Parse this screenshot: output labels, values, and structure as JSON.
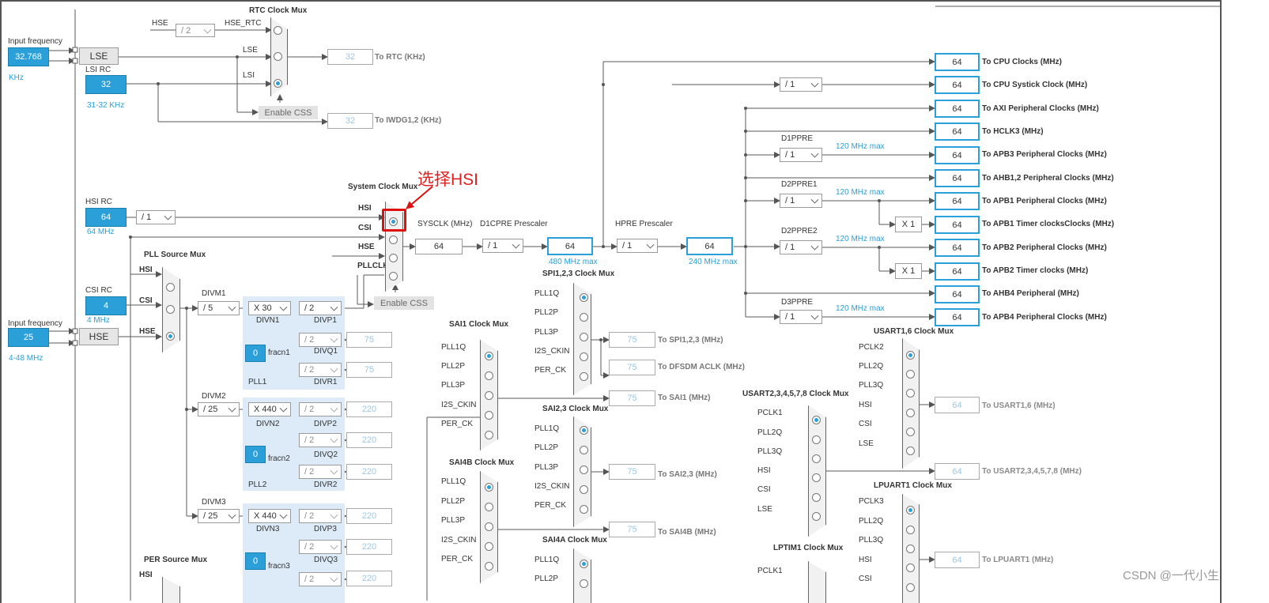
{
  "colors": {
    "accent": "#2a9fd8",
    "wire": "#5a5a5a",
    "highlight": "#e01010",
    "pll_fill": "#dcebf7"
  },
  "annotation": {
    "text": "选择HSI"
  },
  "watermark": {
    "text": "CSDN @一代小生"
  },
  "common": {
    "enable_css": "Enable CSS",
    "fracn_value": "0",
    "max_120": "120 MHz max"
  },
  "lse": {
    "input_label": "Input frequency",
    "value": "32.768",
    "unit": "KHz",
    "block": "LSE"
  },
  "lsi": {
    "label": "LSI RC",
    "value": "32",
    "range": "31-32 KHz"
  },
  "rtc": {
    "title": "RTC Clock Mux",
    "hse": "HSE",
    "div": "/ 2",
    "hse_rtc": "HSE_RTC",
    "lse": "LSE",
    "lsi": "LSI",
    "out": "32",
    "out_label": "To RTC (KHz)",
    "iwdg_out": "32",
    "iwdg_label": "To IWDG1,2 (KHz)"
  },
  "hsi": {
    "label": "HSI RC",
    "value": "64",
    "unit": "64 MHz",
    "div": "/ 1"
  },
  "csi": {
    "label": "CSI RC",
    "value": "4",
    "unit": "4 MHz"
  },
  "hse": {
    "input_label": "Input frequency",
    "value": "25",
    "block": "HSE",
    "range": "4-48 MHz"
  },
  "sysmux": {
    "title": "System Clock Mux",
    "hsi": "HSI",
    "csi": "CSI",
    "hse": "HSE",
    "pllclk": "PLLCLK"
  },
  "pllsrc": {
    "title": "PLL Source Mux",
    "hsi": "HSI",
    "csi": "CSI",
    "hse": "HSE"
  },
  "pll1": {
    "divm_label": "DIVM1",
    "divm": "/ 5",
    "mult": "X 30",
    "divn": "DIVN1",
    "p": "/ 2",
    "p_label": "DIVP1",
    "q": "/ 2",
    "q_label": "DIVQ1",
    "q_out": "75",
    "r": "/ 2",
    "r_label": "DIVR1",
    "r_out": "75",
    "fracn": "fracn1",
    "name": "PLL1"
  },
  "pll2": {
    "divm_label": "DIVM2",
    "divm": "/ 25",
    "mult": "X 440",
    "divn": "DIVN2",
    "p": "/ 2",
    "p_label": "DIVP2",
    "p_out": "220",
    "q": "/ 2",
    "q_label": "DIVQ2",
    "q_out": "220",
    "r": "/ 2",
    "r_label": "DIVR2",
    "r_out": "220",
    "fracn": "fracn2",
    "name": "PLL2"
  },
  "pll3": {
    "divm_label": "DIVM3",
    "divm": "/ 25",
    "mult": "X 440",
    "divn": "DIVN3",
    "p": "/ 2",
    "p_label": "DIVP3",
    "p_out": "220",
    "q": "/ 2",
    "q_label": "DIVQ3",
    "q_out": "220",
    "r": "/ 2",
    "r_out": "220",
    "fracn": "fracn3"
  },
  "per": {
    "title": "PER Source Mux",
    "hsi": "HSI"
  },
  "sys": {
    "sysclk_label": "SYSCLK (MHz)",
    "sysclk": "64",
    "d1cpre_label": "D1CPRE Prescaler",
    "d1cpre": "/ 1",
    "cpu": "64",
    "cpu_max": "480 MHz max",
    "hpre_label": "HPRE Prescaler",
    "hpre": "/ 1",
    "ahb": "64",
    "ahb_max": "240 MHz max",
    "systick_div": "/ 1"
  },
  "dest": [
    {
      "value": "64",
      "label": "To CPU Clocks (MHz)"
    },
    {
      "value": "64",
      "label": "To CPU Systick Clock (MHz)"
    },
    {
      "value": "64",
      "label": "To AXI Peripheral Clocks (MHz)"
    },
    {
      "value": "64",
      "label": "To HCLK3 (MHz)"
    },
    {
      "value": "64",
      "label": "To APB3 Peripheral Clocks (MHz)"
    },
    {
      "value": "64",
      "label": "To AHB1,2 Peripheral Clocks (MHz)"
    },
    {
      "value": "64",
      "label": "To APB1 Peripheral Clocks (MHz)"
    },
    {
      "value": "64",
      "label": "To APB1 Timer clocksClocks (MHz)"
    },
    {
      "value": "64",
      "label": "To APB2 Peripheral Clocks (MHz)"
    },
    {
      "value": "64",
      "label": "To APB2 Timer clocks (MHz)"
    },
    {
      "value": "64",
      "label": "To AHB4 Peripheral (MHz)"
    },
    {
      "value": "64",
      "label": "To APB4 Peripheral Clocks (MHz)"
    }
  ],
  "pre": {
    "d1ppre": "D1PPRE",
    "d1ppre_div": "/ 1",
    "d2ppre1": "D2PPRE1",
    "d2ppre1_div": "/ 1",
    "d2ppre2": "D2PPRE2",
    "d2ppre2_div": "/ 1",
    "d3ppre": "D3PPRE",
    "d3ppre_div": "/ 1",
    "x1": "X 1",
    "x1b": "X 1"
  },
  "spi123": {
    "title": "SPI1,2,3 Clock Mux",
    "inputs": [
      "PLL1Q",
      "PLL2P",
      "PLL3P",
      "I2S_CKIN",
      "PER_CK"
    ],
    "out": "75",
    "out_label": "To SPI1,2,3 (MHz)",
    "dfsdm_out": "75",
    "dfsdm_label": "To DFSDM ACLK (MHz)"
  },
  "sai1": {
    "title": "SAI1 Clock Mux",
    "inputs": [
      "PLL1Q",
      "PLL2P",
      "PLL3P",
      "I2S_CKIN",
      "PER_CK"
    ],
    "out": "75",
    "out_label": "To SAI1 (MHz)"
  },
  "sai23": {
    "title": "SAI2,3 Clock Mux",
    "inputs": [
      "PLL1Q",
      "PLL2P",
      "PLL3P",
      "I2S_CKIN",
      "PER_CK"
    ],
    "out": "75",
    "out_label": "To SAI2,3 (MHz)"
  },
  "sai4b": {
    "title": "SAI4B Clock Mux",
    "inputs": [
      "PLL1Q",
      "PLL2P",
      "PLL3P",
      "I2S_CKIN",
      "PER_CK"
    ],
    "out": "75",
    "out_label": "To SAI4B (MHz)"
  },
  "sai4a": {
    "title": "SAI4A Clock Mux",
    "inputs": [
      "PLL1Q",
      "PLL2P"
    ]
  },
  "usart16": {
    "title": "USART1,6 Clock Mux",
    "inputs": [
      "PCLK2",
      "PLL2Q",
      "PLL3Q",
      "HSI",
      "CSI",
      "LSE"
    ],
    "out": "64",
    "out_label": "To USART1,6 (MHz)"
  },
  "usart2": {
    "title": "USART2,3,4,5,7,8 Clock Mux",
    "inputs": [
      "PCLK1",
      "PLL2Q",
      "PLL3Q",
      "HSI",
      "CSI",
      "LSE"
    ],
    "out": "64",
    "out_label": "To USART2,3,4,5,7,8 (MHz)"
  },
  "lpuart": {
    "title": "LPUART1 Clock Mux",
    "inputs": [
      "PCLK3",
      "PLL2Q",
      "PLL3Q",
      "HSI",
      "CSI"
    ],
    "out": "64",
    "out_label": "To LPUART1 (MHz)"
  },
  "lptim": {
    "title": "LPTIM1 Clock Mux",
    "inputs": [
      "PCLK1"
    ]
  }
}
